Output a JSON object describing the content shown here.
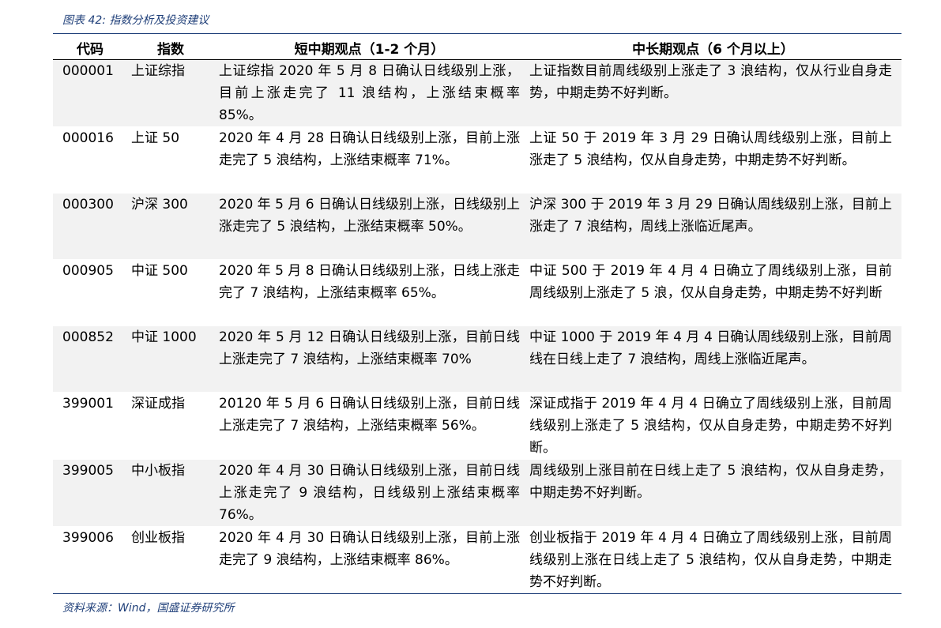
{
  "caption": "图表 42:  指数分析及投资建议",
  "headers": [
    "代码",
    "指数",
    "短中期观点（1-2 个月）",
    "中长期观点（6 个月以上）"
  ],
  "rows": [
    {
      "code": "000001",
      "index": "上证综指",
      "short": "上证综指 2020 年 5 月 8 日确认日线级别上涨，目前上涨走完了 11 浪结构，上涨结束概率 85%。",
      "long": "上证指数目前周线级别上涨走了 3 浪结构，仅从行业自身走势，中期走势不好判断。"
    },
    {
      "code": "000016",
      "index": "上证 50",
      "short": "2020 年 4 月 28 日确认日线级别上涨，目前上涨走完了 5 浪结构，上涨结束概率 71%。",
      "long": "上证 50 于 2019 年 3 月 29 日确认周线级别上涨，目前上涨走了 5 浪结构，仅从自身走势，中期走势不好判断。"
    },
    {
      "code": "000300",
      "index": "沪深 300",
      "short": "2020 年 5 月 6 日确认日线级别上涨，日线级别上涨走完了 5 浪结构，上涨结束概率 50%。",
      "long": "沪深 300 于 2019 年 3 月 29 日确认周线级别上涨，目前上涨走了 7 浪结构，周线上涨临近尾声。"
    },
    {
      "code": "000905",
      "index": "中证 500",
      "short": "2020 年 5 月 8 日确认日线级别上涨，日线上涨走完了 7 浪结构，上涨结束概率 65%。",
      "long": "中证 500 于 2019 年 4 月 4 日确立了周线级别上涨，目前周线级别上涨走了 5 浪，仅从自身走势，中期走势不好判断"
    },
    {
      "code": "000852",
      "index": "中证 1000",
      "short": "2020 年 5 月 12 日确认日线级别上涨，目前日线上涨走完了 7 浪结构，上涨结束概率 70%",
      "long": "中证 1000 于 2019 年 4 月 4 日确认周线级别上涨，目前周线在日线上走了 7 浪结构，周线上涨临近尾声。"
    },
    {
      "code": "399001",
      "index": "深证成指",
      "short": "20120 年 5 月 6 日确认日线级别上涨，目前日线上涨走完了 7 浪结构，上涨结束概率 56%。",
      "long": "深证成指于 2019 年 4 月 4 日确立了周线级别上涨，目前周线级别上涨走了 5 浪结构，仅从自身走势，中期走势不好判断。"
    },
    {
      "code": "399005",
      "index": "中小板指",
      "short": "2020 年 4 月 30 日确认日线级别上涨，目前日线上涨走完了 9 浪结构，日线级别上涨结束概率 76%。",
      "long": "周线级别上涨目前在日线上走了 5 浪结构，仅从自身走势，中期走势不好判断。"
    },
    {
      "code": "399006",
      "index": "创业板指",
      "short": "2020 年 4 月 30 日确认日线级别上涨，目前上涨走完了 9 浪结构，上涨结束概率 86%。",
      "long": "创业板指于 2019 年 4 月 4 日确立了周线级别上涨，目前周线级别上涨在日线上走了 5 浪结构，仅从自身走势，中期走势不好判断。"
    }
  ],
  "source": "资料来源：Wind，国盛证券研究所"
}
